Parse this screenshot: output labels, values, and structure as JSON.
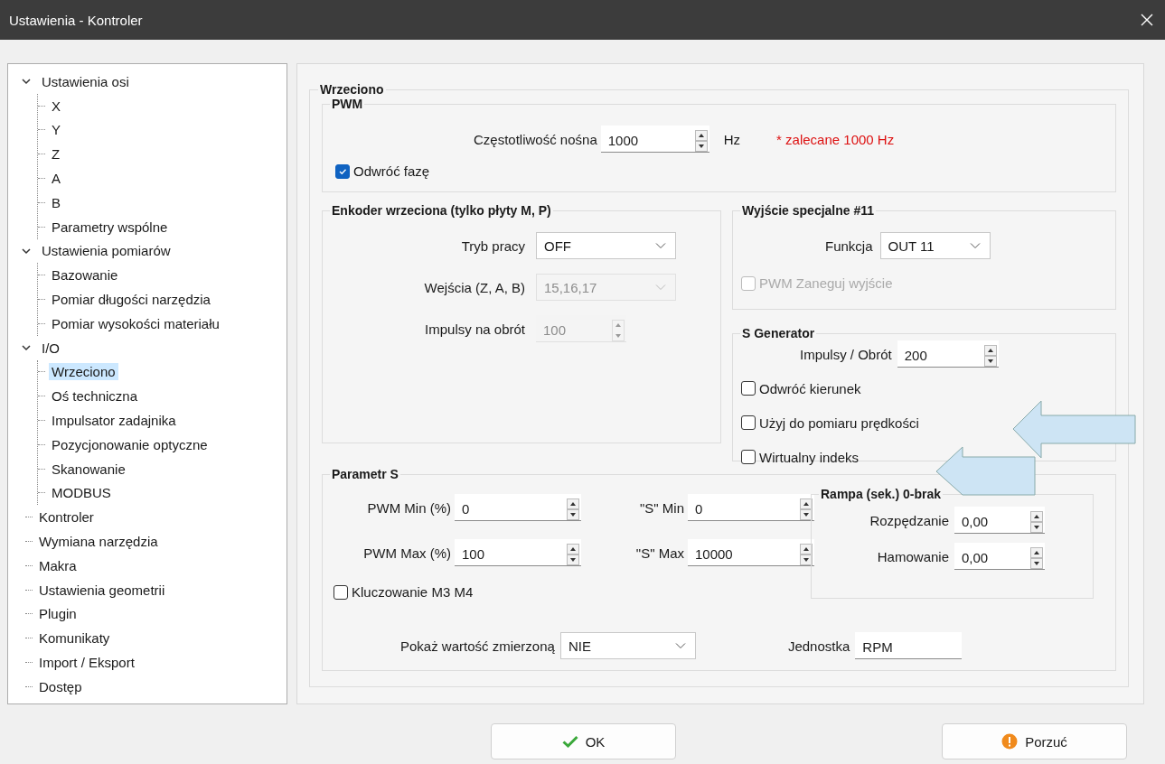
{
  "window": {
    "title": "Ustawienia - Kontroler"
  },
  "tree": [
    {
      "label": "Ustawienia osi",
      "selected": false,
      "expanded": true,
      "children": [
        {
          "label": "X",
          "selected": false
        },
        {
          "label": "Y",
          "selected": false
        },
        {
          "label": "Z",
          "selected": false
        },
        {
          "label": "A",
          "selected": false
        },
        {
          "label": "B",
          "selected": false
        },
        {
          "label": "Parametry wspólne",
          "selected": false
        }
      ]
    },
    {
      "label": "Ustawienia pomiarów",
      "selected": false,
      "expanded": true,
      "children": [
        {
          "label": "Bazowanie",
          "selected": false
        },
        {
          "label": "Pomiar długości narzędzia",
          "selected": false
        },
        {
          "label": "Pomiar wysokości materiału",
          "selected": false
        }
      ]
    },
    {
      "label": "I/O",
      "selected": false,
      "expanded": true,
      "children": [
        {
          "label": "Wrzeciono",
          "selected": true
        },
        {
          "label": "Oś techniczna",
          "selected": false
        },
        {
          "label": "Impulsator zadajnika",
          "selected": false
        },
        {
          "label": "Pozycjonowanie optyczne",
          "selected": false
        },
        {
          "label": "Skanowanie",
          "selected": false
        },
        {
          "label": "MODBUS",
          "selected": false
        }
      ]
    },
    {
      "label": "Kontroler",
      "selected": false
    },
    {
      "label": "Wymiana narzędzia",
      "selected": false
    },
    {
      "label": "Makra",
      "selected": false
    },
    {
      "label": "Ustawienia geometrii",
      "selected": false
    },
    {
      "label": "Plugin",
      "selected": false
    },
    {
      "label": "Komunikaty",
      "selected": false
    },
    {
      "label": "Import / Eksport",
      "selected": false
    },
    {
      "label": "Dostęp",
      "selected": false
    }
  ],
  "group": {
    "title": "Wrzeciono"
  },
  "pwm": {
    "title": "PWM",
    "frequency": {
      "label": "Częstotliwość nośna",
      "value": "1000",
      "unit": "Hz",
      "hint": "* zalecane 1000 Hz"
    },
    "invert_phase": {
      "label": "Odwróć fazę",
      "checked": true
    }
  },
  "encoder": {
    "title": "Enkoder wrzeciona (tylko płyty M, P)",
    "fields": [
      {
        "kind": "select",
        "label": "Tryb pracy",
        "value": "OFF",
        "disabled": false
      },
      {
        "kind": "select",
        "label": "Wejścia (Z, A, B)",
        "value": "15,16,17",
        "disabled": true
      },
      {
        "kind": "spin",
        "label": "Impulsy na obrót",
        "value": "100",
        "disabled": true
      }
    ]
  },
  "special_output": {
    "title": "Wyjście specjalne #11",
    "function": {
      "label": "Funkcja",
      "value": "OUT 11"
    },
    "negate": {
      "label": "PWM Zaneguj wyjście",
      "checked": false,
      "disabled": true
    }
  },
  "s_generator": {
    "title": "S Generator",
    "pulses": {
      "label": "Impulsy / Obrót",
      "value": "200"
    },
    "options": [
      {
        "label": "Odwróć kierunek",
        "checked": false
      },
      {
        "label": "Użyj do pomiaru prędkości",
        "checked": false
      },
      {
        "label": "Wirtualny indeks",
        "checked": false
      }
    ]
  },
  "param_s": {
    "title": "Parametr S",
    "fields": [
      {
        "label": "PWM Min (%)",
        "value": "0"
      },
      {
        "label": "\"S\" Min",
        "value": "0"
      },
      {
        "label": "PWM Max (%)",
        "value": "100"
      },
      {
        "label": "\"S\" Max",
        "value": "10000"
      }
    ],
    "keying": {
      "label": "Kluczowanie M3 M4",
      "checked": false
    },
    "ramp": {
      "title": "Rampa (sek.) 0-brak",
      "fields": [
        {
          "label": "Rozpędzanie",
          "value": "0,00"
        },
        {
          "label": "Hamowanie",
          "value": "0,00"
        }
      ]
    },
    "show_measured": {
      "label": "Pokaż wartość zmierzoną",
      "value": "NIE"
    },
    "unit": {
      "label": "Jednostka",
      "value": "RPM"
    }
  },
  "buttons": [
    {
      "kind": "ok",
      "label": "OK"
    },
    {
      "kind": "cancel",
      "label": "Porzuć"
    }
  ]
}
